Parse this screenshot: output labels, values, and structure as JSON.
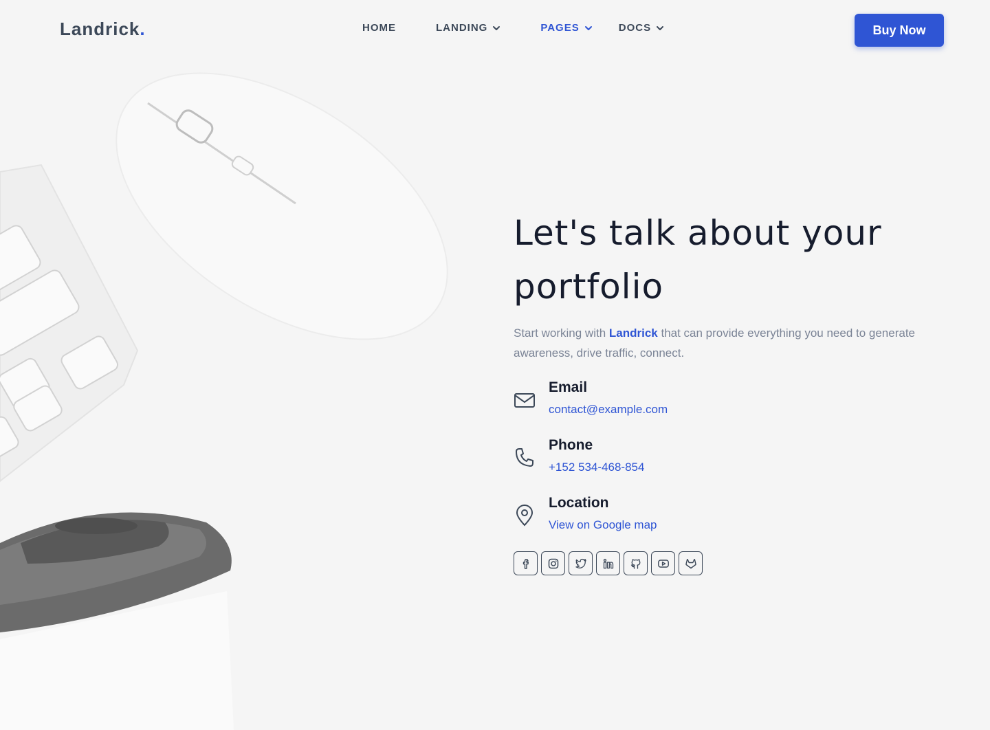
{
  "header": {
    "logo_text": "Landrick",
    "logo_dot": ".",
    "nav": [
      {
        "label": "HOME",
        "has_dropdown": false,
        "active": false
      },
      {
        "label": "LANDING",
        "has_dropdown": true,
        "active": false
      },
      {
        "label": "PAGES",
        "has_dropdown": true,
        "active": true
      },
      {
        "label": "DOCS",
        "has_dropdown": true,
        "active": false
      }
    ],
    "cta_label": "Buy Now"
  },
  "hero": {
    "title_line1": "Let's talk about your",
    "title_line2": "portfolio",
    "lead_prefix": "Start working with ",
    "lead_brand": "Landrick",
    "lead_suffix": " that can provide everything you need to generate awareness, drive traffic, connect."
  },
  "contacts": [
    {
      "icon": "mail-icon",
      "title": "Email",
      "link": "contact@example.com"
    },
    {
      "icon": "phone-icon",
      "title": "Phone",
      "link": "+152 534-468-854"
    },
    {
      "icon": "map-pin-icon",
      "title": "Location",
      "link": "View on Google map"
    }
  ],
  "socials": [
    "facebook-icon",
    "instagram-icon",
    "twitter-icon",
    "linkedin-icon",
    "github-icon",
    "youtube-icon",
    "gitlab-icon"
  ],
  "colors": {
    "accent": "#2f55d4",
    "heading": "#161c2d",
    "text_muted": "#7b8496",
    "background": "#f5f5f5"
  }
}
